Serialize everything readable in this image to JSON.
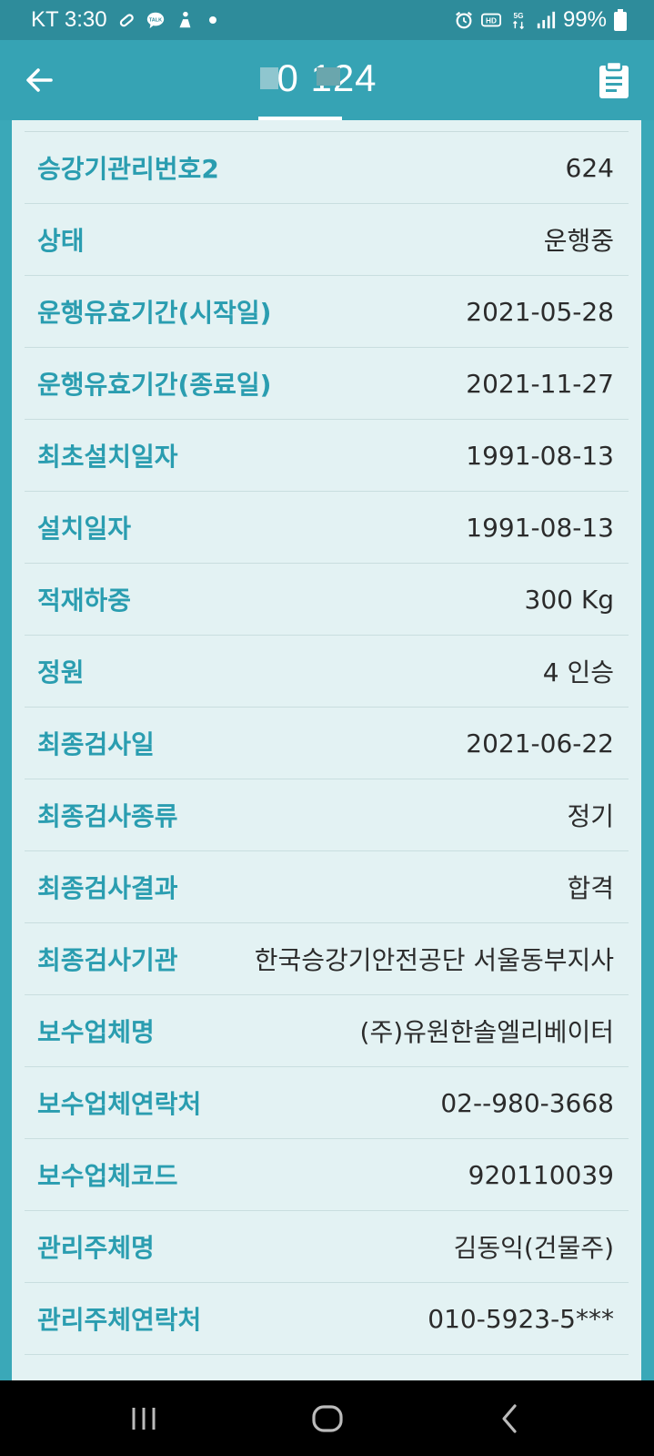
{
  "status_bar": {
    "carrier_time": "KT 3:30",
    "battery": "99%",
    "icons_left": [
      "link-icon",
      "talk-icon",
      "person-icon",
      "dot-icon"
    ],
    "icons_right": [
      "alarm-icon",
      "hd-icon",
      "5g-icon",
      "signal-icon",
      "battery-icon"
    ]
  },
  "app_bar": {
    "title": "0        124",
    "back_icon": "arrow-left-icon",
    "action_icon": "clipboard-icon"
  },
  "details": [
    {
      "label": "승강기관리번호2",
      "value": "624"
    },
    {
      "label": "상태",
      "value": "운행중"
    },
    {
      "label": "운행유효기간(시작일)",
      "value": "2021-05-28"
    },
    {
      "label": "운행유효기간(종료일)",
      "value": "2021-11-27"
    },
    {
      "label": "최초설치일자",
      "value": "1991-08-13"
    },
    {
      "label": "설치일자",
      "value": "1991-08-13"
    },
    {
      "label": "적재하중",
      "value": "300 Kg"
    },
    {
      "label": "정원",
      "value": "4 인승"
    },
    {
      "label": "최종검사일",
      "value": "2021-06-22"
    },
    {
      "label": "최종검사종류",
      "value": "정기"
    },
    {
      "label": "최종검사결과",
      "value": "합격"
    },
    {
      "label": "최종검사기관",
      "value": "한국승강기안전공단 서울동부지사"
    },
    {
      "label": "보수업체명",
      "value": "(주)유원한솔엘리베이터"
    },
    {
      "label": "보수업체연락처",
      "value": "02--980-3668"
    },
    {
      "label": "보수업체코드",
      "value": "920110039"
    },
    {
      "label": "관리주체명",
      "value": "김동익(건물주)"
    },
    {
      "label": "관리주체연락처",
      "value": "010-5923-5***"
    }
  ],
  "nav_bar": {
    "items": [
      "recent-apps-icon",
      "home-icon",
      "back-icon"
    ]
  },
  "colors": {
    "status_bar": "#2e8c9b",
    "app_bar": "#36a3b4",
    "card": "#e3f2f3",
    "label": "#2a9db0"
  }
}
